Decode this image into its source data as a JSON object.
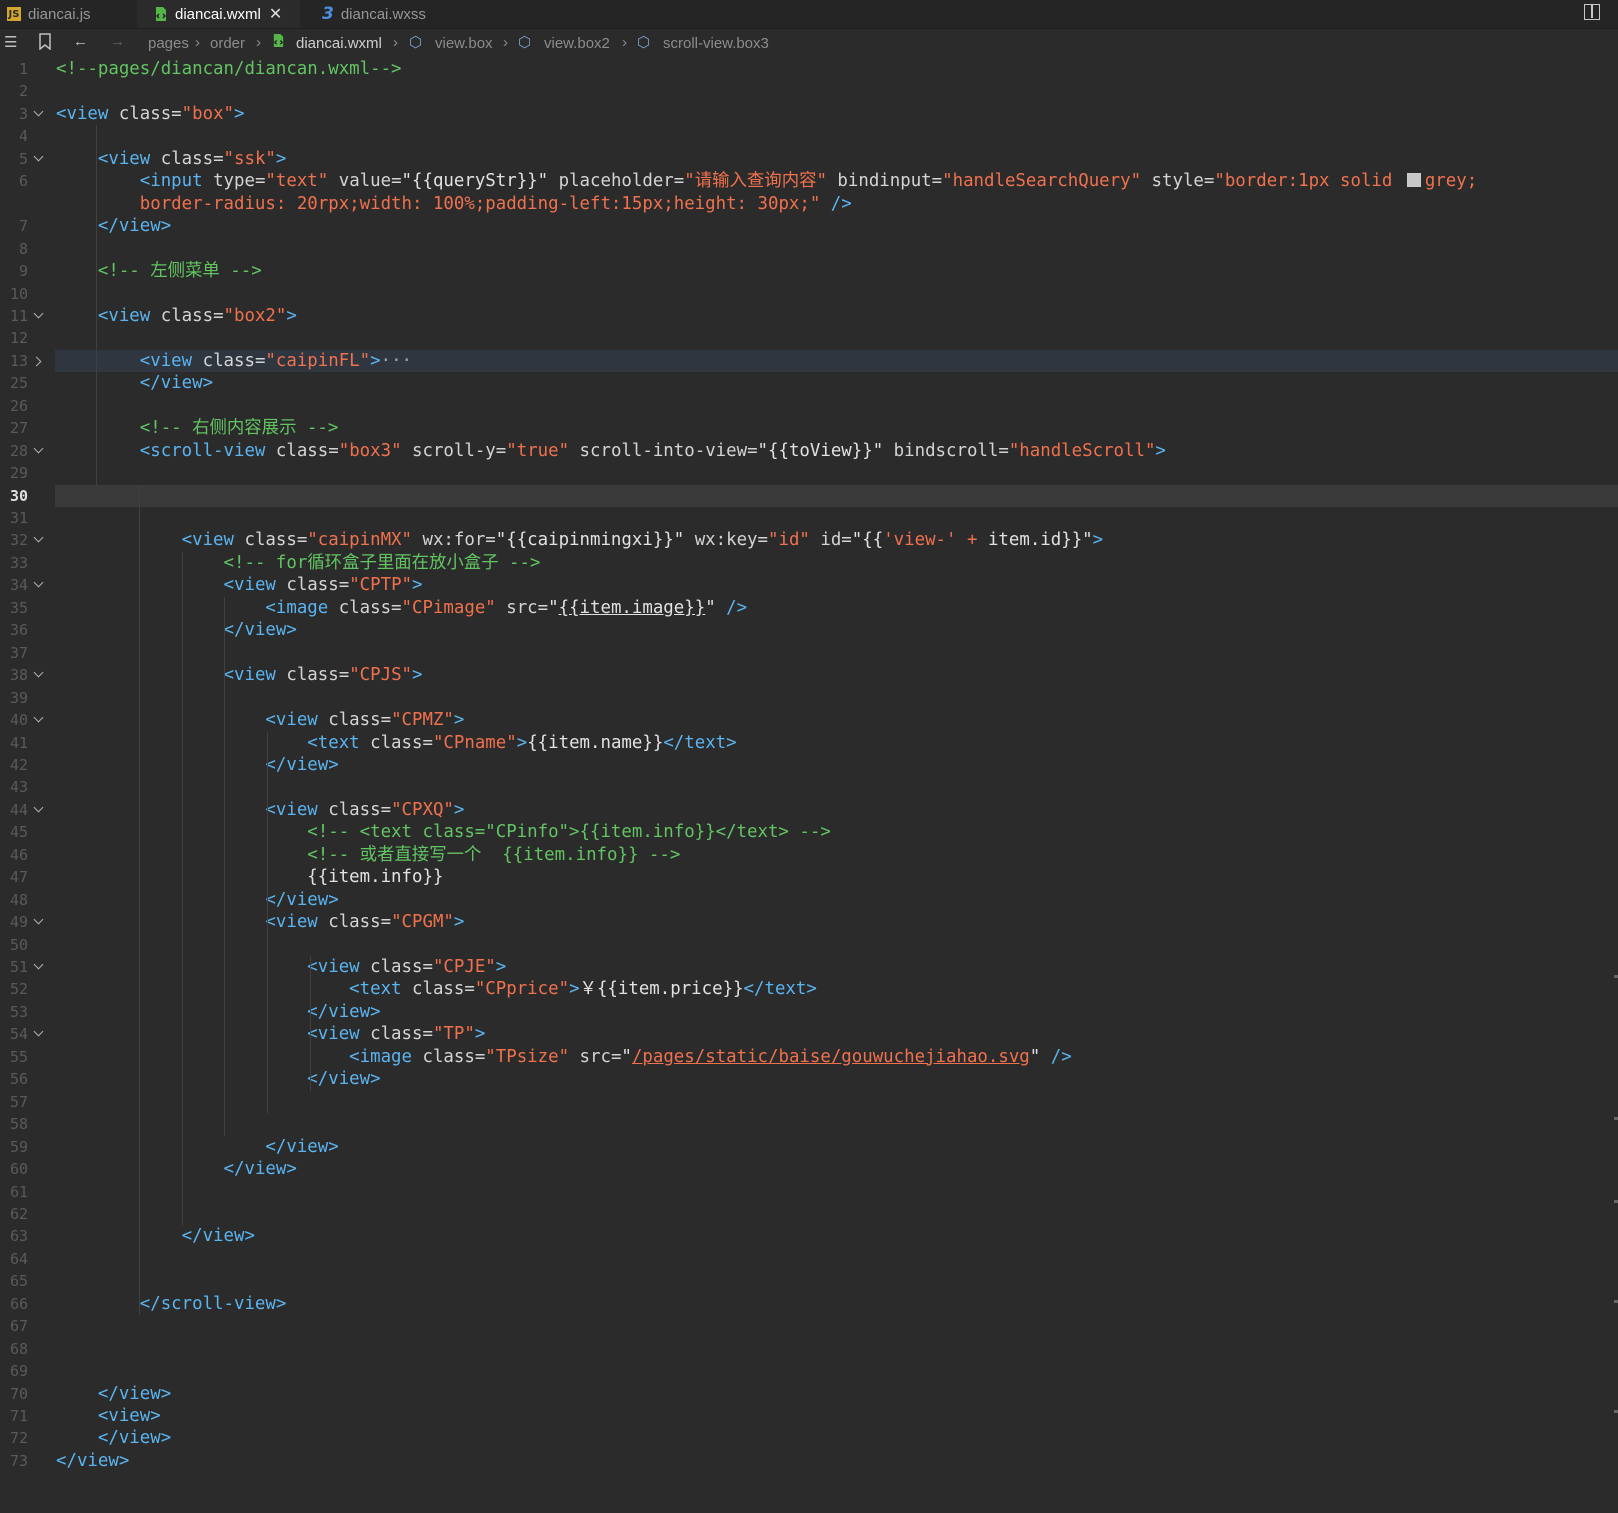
{
  "tabs": [
    {
      "label": "diancai.js",
      "icon": "js-file-icon"
    },
    {
      "label": "diancai.wxml",
      "icon": "wxml-file-icon",
      "active": true
    },
    {
      "label": "diancai.wxss",
      "icon": "css-file-icon"
    }
  ],
  "breadcrumb": [
    "pages",
    "order",
    "diancai.wxml",
    "view.box",
    "view.box2",
    "scroll-view.box3"
  ],
  "current_line": 30,
  "folded_ellipsis": "···",
  "lines": [
    {
      "n": "1",
      "t": [
        [
          "c",
          "<!--pages/diancan/diancan.wxml-->"
        ]
      ]
    },
    {
      "n": "2",
      "t": []
    },
    {
      "n": "3",
      "t": [
        [
          "t",
          "<view "
        ],
        [
          "a",
          "class="
        ],
        [
          "s",
          "\"box\""
        ],
        [
          "t",
          ">"
        ]
      ]
    },
    {
      "n": "4",
      "t": []
    },
    {
      "n": "5",
      "t": [
        [
          "a",
          "    "
        ],
        [
          "t",
          "<view "
        ],
        [
          "a",
          "class="
        ],
        [
          "s",
          "\"ssk\""
        ],
        [
          "t",
          ">"
        ]
      ]
    },
    {
      "n": "6",
      "t": [
        [
          "a",
          "        "
        ],
        [
          "t",
          "<input "
        ],
        [
          "a",
          "type="
        ],
        [
          "s",
          "\"text\""
        ],
        [
          "a",
          " value="
        ],
        [
          "q",
          "\"{{queryStr}}\""
        ],
        [
          "a",
          " placeholder="
        ],
        [
          "s",
          "\"请输入查询内容\""
        ],
        [
          "a",
          " bindinput="
        ],
        [
          "s",
          "\"handleSearchQuery\""
        ],
        [
          "a",
          " style="
        ],
        [
          "s",
          "\"border:1px solid "
        ]
      ]
    },
    {
      "n": "",
      "t": [
        [
          "a",
          "        "
        ],
        [
          "s",
          "border-radius: 20rpx;width: 100%;padding-left:15px;height: 30px;\""
        ],
        [
          "t",
          " />"
        ]
      ]
    },
    {
      "n": "7",
      "t": [
        [
          "a",
          "    "
        ],
        [
          "t",
          "</view>"
        ]
      ]
    },
    {
      "n": "8",
      "t": []
    },
    {
      "n": "9",
      "t": [
        [
          "a",
          "    "
        ],
        [
          "c",
          "<!-- 左侧菜单 -->"
        ]
      ]
    },
    {
      "n": "10",
      "t": []
    },
    {
      "n": "11",
      "t": [
        [
          "a",
          "    "
        ],
        [
          "t",
          "<view "
        ],
        [
          "a",
          "class="
        ],
        [
          "s",
          "\"box2\""
        ],
        [
          "t",
          ">"
        ]
      ]
    },
    {
      "n": "12",
      "t": []
    },
    {
      "n": "13",
      "t": [
        [
          "a",
          "        "
        ],
        [
          "t",
          "<view "
        ],
        [
          "a",
          "class="
        ],
        [
          "s",
          "\"caipinFL\""
        ],
        [
          "t",
          ">"
        ]
      ]
    },
    {
      "n": "25",
      "t": [
        [
          "a",
          "        "
        ],
        [
          "t",
          "</view>"
        ]
      ]
    },
    {
      "n": "26",
      "t": []
    },
    {
      "n": "27",
      "t": [
        [
          "a",
          "        "
        ],
        [
          "c",
          "<!-- 右侧内容展示 -->"
        ]
      ]
    },
    {
      "n": "28",
      "t": [
        [
          "a",
          "        "
        ],
        [
          "t",
          "<scroll-view "
        ],
        [
          "a",
          "class="
        ],
        [
          "s",
          "\"box3\""
        ],
        [
          "a",
          " scroll-y="
        ],
        [
          "s",
          "\"true\""
        ],
        [
          "a",
          " scroll-into-view="
        ],
        [
          "q",
          "\"{{toView}}\""
        ],
        [
          "a",
          " bindscroll="
        ],
        [
          "s",
          "\"handleScroll\""
        ],
        [
          "t",
          ">"
        ]
      ]
    },
    {
      "n": "29",
      "t": []
    },
    {
      "n": "30",
      "t": []
    },
    {
      "n": "31",
      "t": []
    },
    {
      "n": "32",
      "t": [
        [
          "a",
          "            "
        ],
        [
          "t",
          "<view "
        ],
        [
          "a",
          "class="
        ],
        [
          "s",
          "\"caipinMX\""
        ],
        [
          "a",
          " wx:for="
        ],
        [
          "q",
          "\"{{caipinmingxi}}\""
        ],
        [
          "a",
          " wx:key="
        ],
        [
          "s",
          "\"id\""
        ],
        [
          "a",
          " id="
        ],
        [
          "q",
          "\"{{"
        ],
        [
          "s",
          "'view-'"
        ],
        [
          "q",
          " "
        ],
        [
          "s",
          "+"
        ],
        [
          "q",
          " item.id}}\""
        ],
        [
          "t",
          ">"
        ]
      ]
    },
    {
      "n": "33",
      "t": [
        [
          "a",
          "                "
        ],
        [
          "c",
          "<!-- for循环盒子里面在放小盒子 -->"
        ]
      ]
    },
    {
      "n": "34",
      "t": [
        [
          "a",
          "                "
        ],
        [
          "t",
          "<view "
        ],
        [
          "a",
          "class="
        ],
        [
          "s",
          "\"CPTP\""
        ],
        [
          "t",
          ">"
        ]
      ]
    },
    {
      "n": "35",
      "t": [
        [
          "a",
          "                    "
        ],
        [
          "t",
          "<image "
        ],
        [
          "a",
          "class="
        ],
        [
          "s",
          "\"CPimage\""
        ],
        [
          "a",
          " src="
        ],
        [
          "q",
          "\""
        ],
        [
          "qu",
          "{{item.image}}"
        ],
        [
          "q",
          "\""
        ],
        [
          "t",
          " />"
        ]
      ]
    },
    {
      "n": "36",
      "t": [
        [
          "a",
          "                "
        ],
        [
          "t",
          "</view>"
        ]
      ]
    },
    {
      "n": "37",
      "t": []
    },
    {
      "n": "38",
      "t": [
        [
          "a",
          "                "
        ],
        [
          "t",
          "<view "
        ],
        [
          "a",
          "class="
        ],
        [
          "s",
          "\"CPJS\""
        ],
        [
          "t",
          ">"
        ]
      ]
    },
    {
      "n": "39",
      "t": []
    },
    {
      "n": "40",
      "t": [
        [
          "a",
          "                    "
        ],
        [
          "t",
          "<view "
        ],
        [
          "a",
          "class="
        ],
        [
          "s",
          "\"CPMZ\""
        ],
        [
          "t",
          ">"
        ]
      ]
    },
    {
      "n": "41",
      "t": [
        [
          "a",
          "                        "
        ],
        [
          "t",
          "<text "
        ],
        [
          "a",
          "class="
        ],
        [
          "s",
          "\"CPname\""
        ],
        [
          "t",
          ">"
        ],
        [
          "q",
          "{{item.name}}"
        ],
        [
          "t",
          "</text>"
        ]
      ]
    },
    {
      "n": "42",
      "t": [
        [
          "a",
          "                    "
        ],
        [
          "t",
          "</view>"
        ]
      ]
    },
    {
      "n": "43",
      "t": []
    },
    {
      "n": "44",
      "t": [
        [
          "a",
          "                    "
        ],
        [
          "t",
          "<view "
        ],
        [
          "a",
          "class="
        ],
        [
          "s",
          "\"CPXQ\""
        ],
        [
          "t",
          ">"
        ]
      ]
    },
    {
      "n": "45",
      "t": [
        [
          "a",
          "                        "
        ],
        [
          "c",
          "<!-- <text class=\"CPinfo\">{{item.info}}</text> -->"
        ]
      ]
    },
    {
      "n": "46",
      "t": [
        [
          "a",
          "                        "
        ],
        [
          "c",
          "<!-- 或者直接写一个  {{item.info}} -->"
        ]
      ]
    },
    {
      "n": "47",
      "t": [
        [
          "a",
          "                        "
        ],
        [
          "q",
          "{{item.info}}"
        ]
      ]
    },
    {
      "n": "48",
      "t": [
        [
          "a",
          "                    "
        ],
        [
          "t",
          "</view>"
        ]
      ]
    },
    {
      "n": "49",
      "t": [
        [
          "a",
          "                    "
        ],
        [
          "t",
          "<view "
        ],
        [
          "a",
          "class="
        ],
        [
          "s",
          "\"CPGM\""
        ],
        [
          "t",
          ">"
        ]
      ]
    },
    {
      "n": "50",
      "t": []
    },
    {
      "n": "51",
      "t": [
        [
          "a",
          "                        "
        ],
        [
          "t",
          "<view "
        ],
        [
          "a",
          "class="
        ],
        [
          "s",
          "\"CPJE\""
        ],
        [
          "t",
          ">"
        ]
      ]
    },
    {
      "n": "52",
      "t": [
        [
          "a",
          "                            "
        ],
        [
          "t",
          "<text "
        ],
        [
          "a",
          "class="
        ],
        [
          "s",
          "\"CPprice\""
        ],
        [
          "t",
          ">"
        ],
        [
          "q",
          "￥{{item.price}}"
        ],
        [
          "t",
          "</text>"
        ]
      ]
    },
    {
      "n": "53",
      "t": [
        [
          "a",
          "                        "
        ],
        [
          "t",
          "</view>"
        ]
      ]
    },
    {
      "n": "54",
      "t": [
        [
          "a",
          "                        "
        ],
        [
          "t",
          "<view "
        ],
        [
          "a",
          "class="
        ],
        [
          "s",
          "\"TP\""
        ],
        [
          "t",
          ">"
        ]
      ]
    },
    {
      "n": "55",
      "t": [
        [
          "a",
          "                            "
        ],
        [
          "t",
          "<image "
        ],
        [
          "a",
          "class="
        ],
        [
          "s",
          "\"TPsize\""
        ],
        [
          "a",
          " src="
        ],
        [
          "q",
          "\""
        ],
        [
          "su",
          "/pages/static/baise/gouwuchejiahao.svg"
        ],
        [
          "q",
          "\""
        ],
        [
          "t",
          " />"
        ]
      ]
    },
    {
      "n": "56",
      "t": [
        [
          "a",
          "                        "
        ],
        [
          "t",
          "</view>"
        ]
      ]
    },
    {
      "n": "57",
      "t": []
    },
    {
      "n": "58",
      "t": []
    },
    {
      "n": "59",
      "t": [
        [
          "a",
          "                    "
        ],
        [
          "t",
          "</view>"
        ]
      ]
    },
    {
      "n": "60",
      "t": [
        [
          "a",
          "                "
        ],
        [
          "t",
          "</view>"
        ]
      ]
    },
    {
      "n": "61",
      "t": []
    },
    {
      "n": "62",
      "t": []
    },
    {
      "n": "63",
      "t": [
        [
          "a",
          "            "
        ],
        [
          "t",
          "</view>"
        ]
      ]
    },
    {
      "n": "64",
      "t": []
    },
    {
      "n": "65",
      "t": []
    },
    {
      "n": "66",
      "t": [
        [
          "a",
          "        "
        ],
        [
          "t",
          "</scroll-view>"
        ]
      ]
    },
    {
      "n": "67",
      "t": []
    },
    {
      "n": "68",
      "t": []
    },
    {
      "n": "69",
      "t": []
    },
    {
      "n": "70",
      "t": [
        [
          "a",
          "    "
        ],
        [
          "t",
          "</view>"
        ]
      ]
    },
    {
      "n": "71",
      "t": [
        [
          "a",
          "    "
        ],
        [
          "t",
          "<view>"
        ]
      ]
    },
    {
      "n": "72",
      "t": [
        [
          "a",
          "    "
        ],
        [
          "t",
          "</view>"
        ]
      ]
    },
    {
      "n": "73",
      "t": [
        [
          "t",
          "</view>"
        ]
      ]
    }
  ],
  "line6_tail": "grey;",
  "colors": {
    "tag": "#5ab4f0",
    "string": "#f0714e",
    "comment": "#62c462",
    "text": "#d4d4d4",
    "background": "#2b2b2b"
  }
}
